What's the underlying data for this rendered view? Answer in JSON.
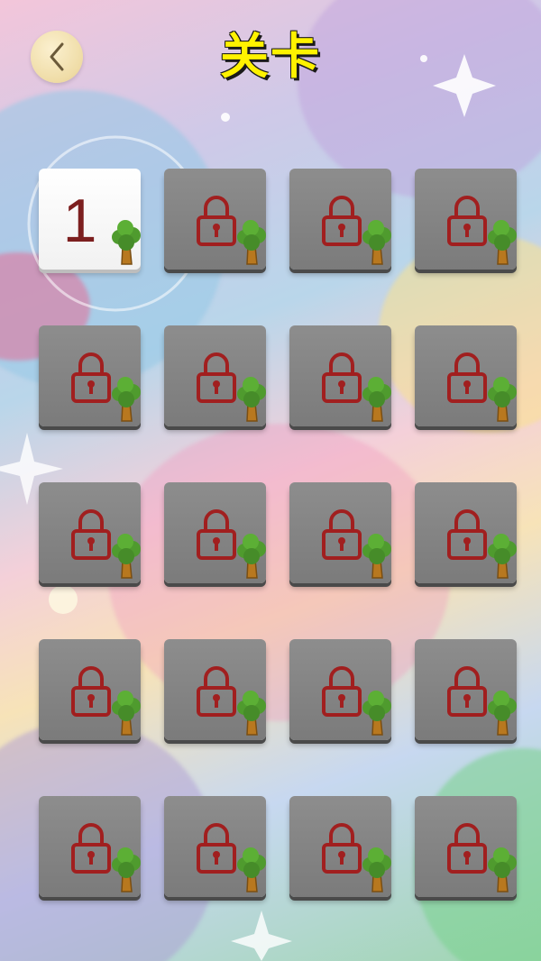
{
  "header": {
    "title": "关卡",
    "back_icon": "chevron-left-icon"
  },
  "colors": {
    "title": "#fff200",
    "lock": "#a11f1f",
    "tile_locked": "#808080",
    "tile_unlocked": "#ffffff",
    "level_number": "#7c1f1f"
  },
  "levels": [
    {
      "label": "1",
      "state": "unlocked",
      "icons": [
        "tree-icon"
      ]
    },
    {
      "label": "",
      "state": "locked",
      "icons": [
        "lock-icon",
        "tree-icon"
      ]
    },
    {
      "label": "",
      "state": "locked",
      "icons": [
        "lock-icon",
        "tree-icon"
      ]
    },
    {
      "label": "",
      "state": "locked",
      "icons": [
        "lock-icon",
        "tree-icon"
      ]
    },
    {
      "label": "",
      "state": "locked",
      "icons": [
        "lock-icon",
        "tree-icon"
      ]
    },
    {
      "label": "",
      "state": "locked",
      "icons": [
        "lock-icon",
        "tree-icon"
      ]
    },
    {
      "label": "",
      "state": "locked",
      "icons": [
        "lock-icon",
        "tree-icon"
      ]
    },
    {
      "label": "",
      "state": "locked",
      "icons": [
        "lock-icon",
        "tree-icon"
      ]
    },
    {
      "label": "",
      "state": "locked",
      "icons": [
        "lock-icon",
        "tree-icon"
      ]
    },
    {
      "label": "",
      "state": "locked",
      "icons": [
        "lock-icon",
        "tree-icon"
      ]
    },
    {
      "label": "",
      "state": "locked",
      "icons": [
        "lock-icon",
        "tree-icon"
      ]
    },
    {
      "label": "",
      "state": "locked",
      "icons": [
        "lock-icon",
        "tree-icon"
      ]
    },
    {
      "label": "",
      "state": "locked",
      "icons": [
        "lock-icon",
        "tree-icon"
      ]
    },
    {
      "label": "",
      "state": "locked",
      "icons": [
        "lock-icon",
        "tree-icon"
      ]
    },
    {
      "label": "",
      "state": "locked",
      "icons": [
        "lock-icon",
        "tree-icon"
      ]
    },
    {
      "label": "",
      "state": "locked",
      "icons": [
        "lock-icon",
        "tree-icon"
      ]
    },
    {
      "label": "",
      "state": "locked",
      "icons": [
        "lock-icon",
        "tree-icon"
      ]
    },
    {
      "label": "",
      "state": "locked",
      "icons": [
        "lock-icon",
        "tree-icon"
      ]
    },
    {
      "label": "",
      "state": "locked",
      "icons": [
        "lock-icon",
        "tree-icon"
      ]
    },
    {
      "label": "",
      "state": "locked",
      "icons": [
        "lock-icon",
        "tree-icon"
      ]
    }
  ]
}
